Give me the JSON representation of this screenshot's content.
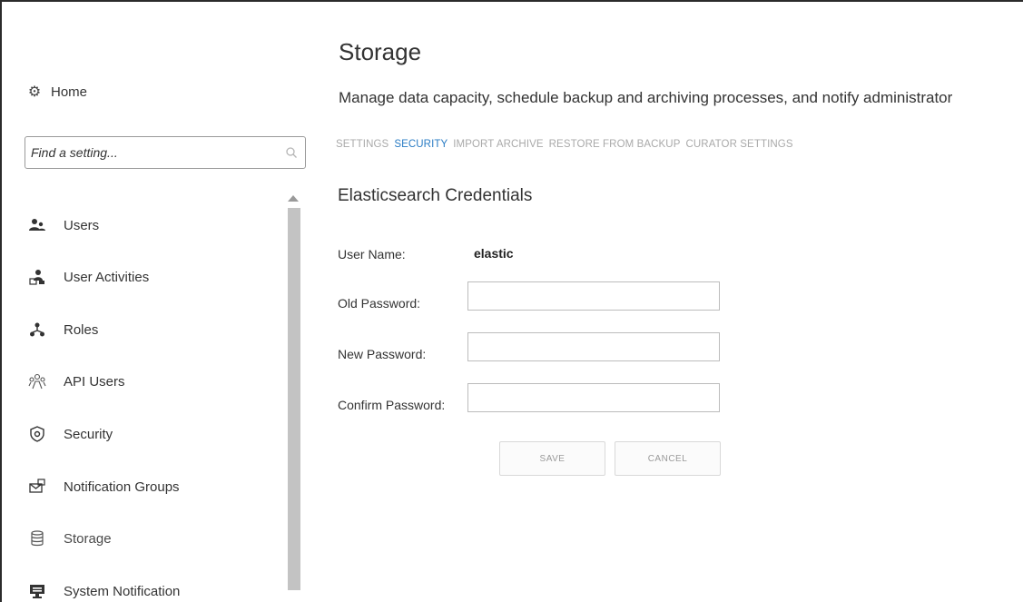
{
  "sidebar": {
    "home_label": "Home",
    "search": {
      "placeholder": "Find a setting..."
    },
    "items": [
      {
        "label": "Users",
        "icon": "users-icon"
      },
      {
        "label": "User Activities",
        "icon": "user-activities-icon"
      },
      {
        "label": "Roles",
        "icon": "roles-icon"
      },
      {
        "label": "API Users",
        "icon": "api-users-icon"
      },
      {
        "label": "Security",
        "icon": "shield-icon"
      },
      {
        "label": "Notification Groups",
        "icon": "notification-groups-icon"
      },
      {
        "label": "Storage",
        "icon": "database-icon"
      },
      {
        "label": "System Notification",
        "icon": "system-notification-icon"
      }
    ]
  },
  "main": {
    "title": "Storage",
    "subtitle": "Manage data capacity, schedule backup and archiving processes, and notify administrator",
    "tabs": [
      {
        "label": "SETTINGS",
        "active": false
      },
      {
        "label": "SECURITY",
        "active": true
      },
      {
        "label": "IMPORT ARCHIVE",
        "active": false
      },
      {
        "label": "RESTORE FROM BACKUP",
        "active": false
      },
      {
        "label": "CURATOR SETTINGS",
        "active": false
      }
    ],
    "section_title": "Elasticsearch Credentials",
    "form": {
      "username_label": "User Name:",
      "username_value": "elastic",
      "old_password_label": "Old Password:",
      "new_password_label": "New Password:",
      "confirm_password_label": "Confirm Password:",
      "save_label": "SAVE",
      "cancel_label": "CANCEL"
    }
  },
  "colors": {
    "accent": "#2a7cc4",
    "tab_inactive": "#a9a9a9",
    "scrollbar": "#c3c3c3"
  }
}
